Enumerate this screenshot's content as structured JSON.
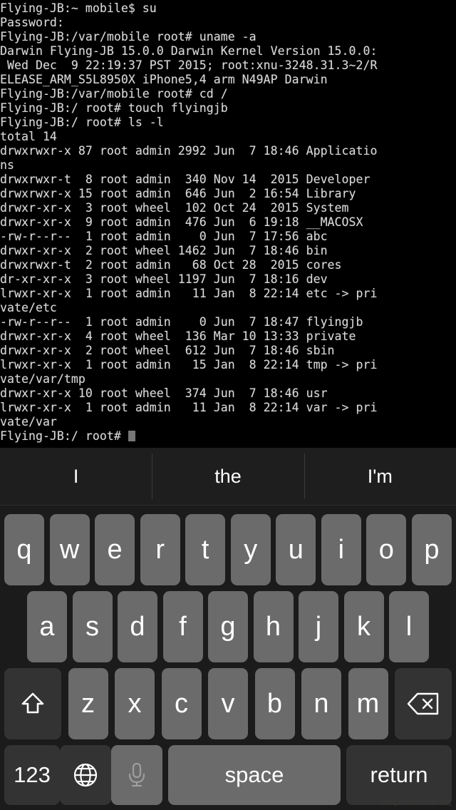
{
  "terminal": {
    "lines": [
      "Flying-JB:~ mobile$ su",
      "Password:",
      "Flying-JB:/var/mobile root# uname -a",
      "Darwin Flying-JB 15.0.0 Darwin Kernel Version 15.0.0:",
      " Wed Dec  9 22:19:37 PST 2015; root:xnu-3248.31.3~2/R",
      "ELEASE_ARM_S5L8950X iPhone5,4 arm N49AP Darwin",
      "Flying-JB:/var/mobile root# cd /",
      "Flying-JB:/ root# touch flyingjb",
      "Flying-JB:/ root# ls -l",
      "total 14",
      "drwxrwxr-x 87 root admin 2992 Jun  7 18:46 Applicatio",
      "ns",
      "drwxrwxr-t  8 root admin  340 Nov 14  2015 Developer",
      "drwxrwxr-x 15 root admin  646 Jun  2 16:54 Library",
      "drwxr-xr-x  3 root wheel  102 Oct 24  2015 System",
      "drwxr-xr-x  9 root admin  476 Jun  6 19:18 __MACOSX",
      "-rw-r--r--  1 root admin    0 Jun  7 17:56 abc",
      "drwxr-xr-x  2 root wheel 1462 Jun  7 18:46 bin",
      "drwxrwxr-t  2 root admin   68 Oct 28  2015 cores",
      "dr-xr-xr-x  3 root wheel 1197 Jun  7 18:16 dev",
      "lrwxr-xr-x  1 root admin   11 Jan  8 22:14 etc -> pri",
      "vate/etc",
      "-rw-r--r--  1 root admin    0 Jun  7 18:47 flyingjb",
      "drwxr-xr-x  4 root wheel  136 Mar 10 13:33 private",
      "drwxr-xr-x  2 root wheel  612 Jun  7 18:46 sbin",
      "lrwxr-xr-x  1 root admin   15 Jan  8 22:14 tmp -> pri",
      "vate/var/tmp",
      "drwxr-xr-x 10 root wheel  374 Jun  7 18:46 usr",
      "lrwxr-xr-x  1 root admin   11 Jan  8 22:14 var -> pri",
      "vate/var"
    ],
    "prompt": "Flying-JB:/ root# ",
    "cursor": "block-cursor"
  },
  "keyboard": {
    "predictions": [
      "I",
      "the",
      "I'm"
    ],
    "row1": [
      "q",
      "w",
      "e",
      "r",
      "t",
      "y",
      "u",
      "i",
      "o",
      "p"
    ],
    "row2": [
      "a",
      "s",
      "d",
      "f",
      "g",
      "h",
      "j",
      "k",
      "l"
    ],
    "row3_letters": [
      "z",
      "x",
      "c",
      "v",
      "b",
      "n",
      "m"
    ],
    "shift_label": "shift-key",
    "backspace_label": "backspace-key",
    "numbers_label": "123",
    "globe_label": "globe-key",
    "mic_label": "microphone-key",
    "space_label": "space",
    "return_label": "return"
  },
  "watermark": {
    "text": "dropsxwoovm.org"
  },
  "colors": {
    "terminal_bg": "#000000",
    "terminal_text": "#d9d9d9",
    "keyboard_bg": "#1b1b1b",
    "key_light": "#6b6b6b",
    "key_dark": "#333333",
    "prediction_bg": "#1e1e1e"
  }
}
